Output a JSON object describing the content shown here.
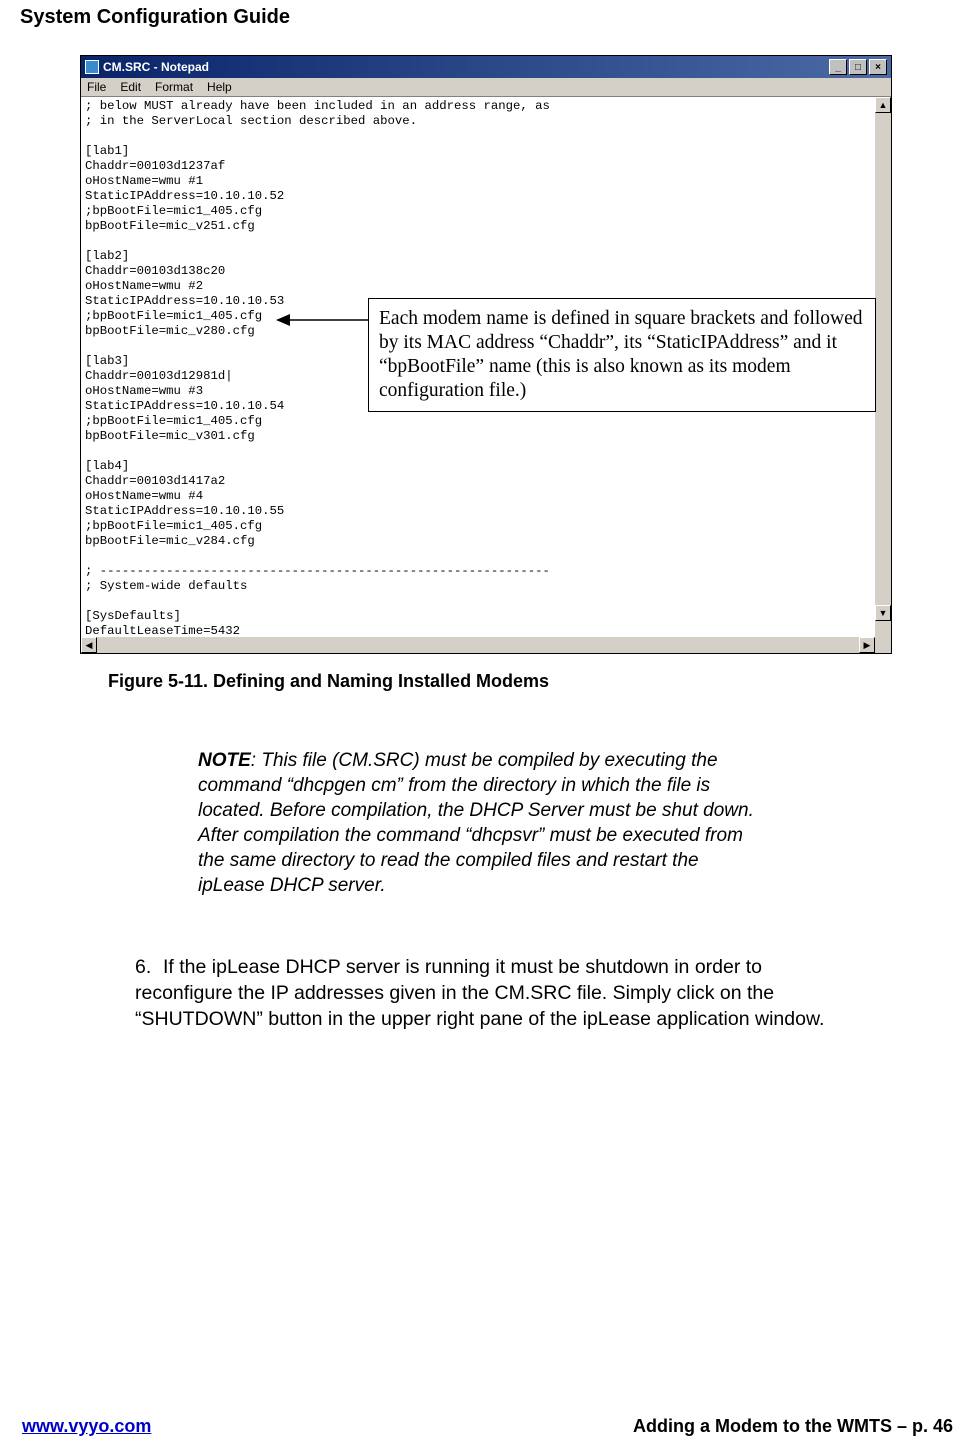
{
  "header": {
    "title": "System Configuration Guide"
  },
  "notepad": {
    "title": "CM.SRC - Notepad",
    "menu": {
      "file": "File",
      "edit": "Edit",
      "format": "Format",
      "help": "Help"
    },
    "controls": {
      "min": "_",
      "max": "□",
      "close": "×"
    },
    "content": "; below MUST already have been included in an address range, as\n; in the ServerLocal section described above.\n\n[lab1]\nChaddr=00103d1237af\noHostName=wmu #1\nStaticIPAddress=10.10.10.52\n;bpBootFile=mic1_405.cfg\nbpBootFile=mic_v251.cfg\n\n[lab2]\nChaddr=00103d138c20\noHostName=wmu #2\nStaticIPAddress=10.10.10.53\n;bpBootFile=mic1_405.cfg\nbpBootFile=mic_v280.cfg\n\n[lab3]\nChaddr=00103d12981d|\noHostName=wmu #3\nStaticIPAddress=10.10.10.54\n;bpBootFile=mic1_405.cfg\nbpBootFile=mic_v301.cfg\n\n[lab4]\nChaddr=00103d1417a2\noHostName=wmu #4\nStaticIPAddress=10.10.10.55\n;bpBootFile=mic1_405.cfg\nbpBootFile=mic_v284.cfg\n\n; -------------------------------------------------------------\n; System-wide defaults\n\n[SysDefaults]\nDefaultLeaseTime=5432"
  },
  "callout": {
    "text": "Each modem name is defined in square brackets and followed by its MAC address “Chaddr”, its “StaticIPAddress” and it “bpBootFile” name (this is also known as its modem configuration file.)"
  },
  "figure_caption": "Figure 5-11. Defining and Naming Installed Modems",
  "note": {
    "label": "NOTE",
    "body": ": This file (CM.SRC) must be compiled by executing the command “dhcpgen cm” from the directory in which the file is located.  Before compilation, the DHCP Server must be shut down.  After compilation the command “dhcpsvr” must be executed from the same directory to read the compiled files and restart the ipLease DHCP server."
  },
  "step6": {
    "number": "6.",
    "text": "If the ipLease DHCP server is running it must be shutdown in order to reconfigure the IP addresses given in the CM.SRC file.  Simply click on the “SHUTDOWN” button in the upper right pane of the ipLease application window."
  },
  "footer": {
    "left": "www.vyyo.com",
    "right": "Adding a Modem to the WMTS – p. 46"
  }
}
